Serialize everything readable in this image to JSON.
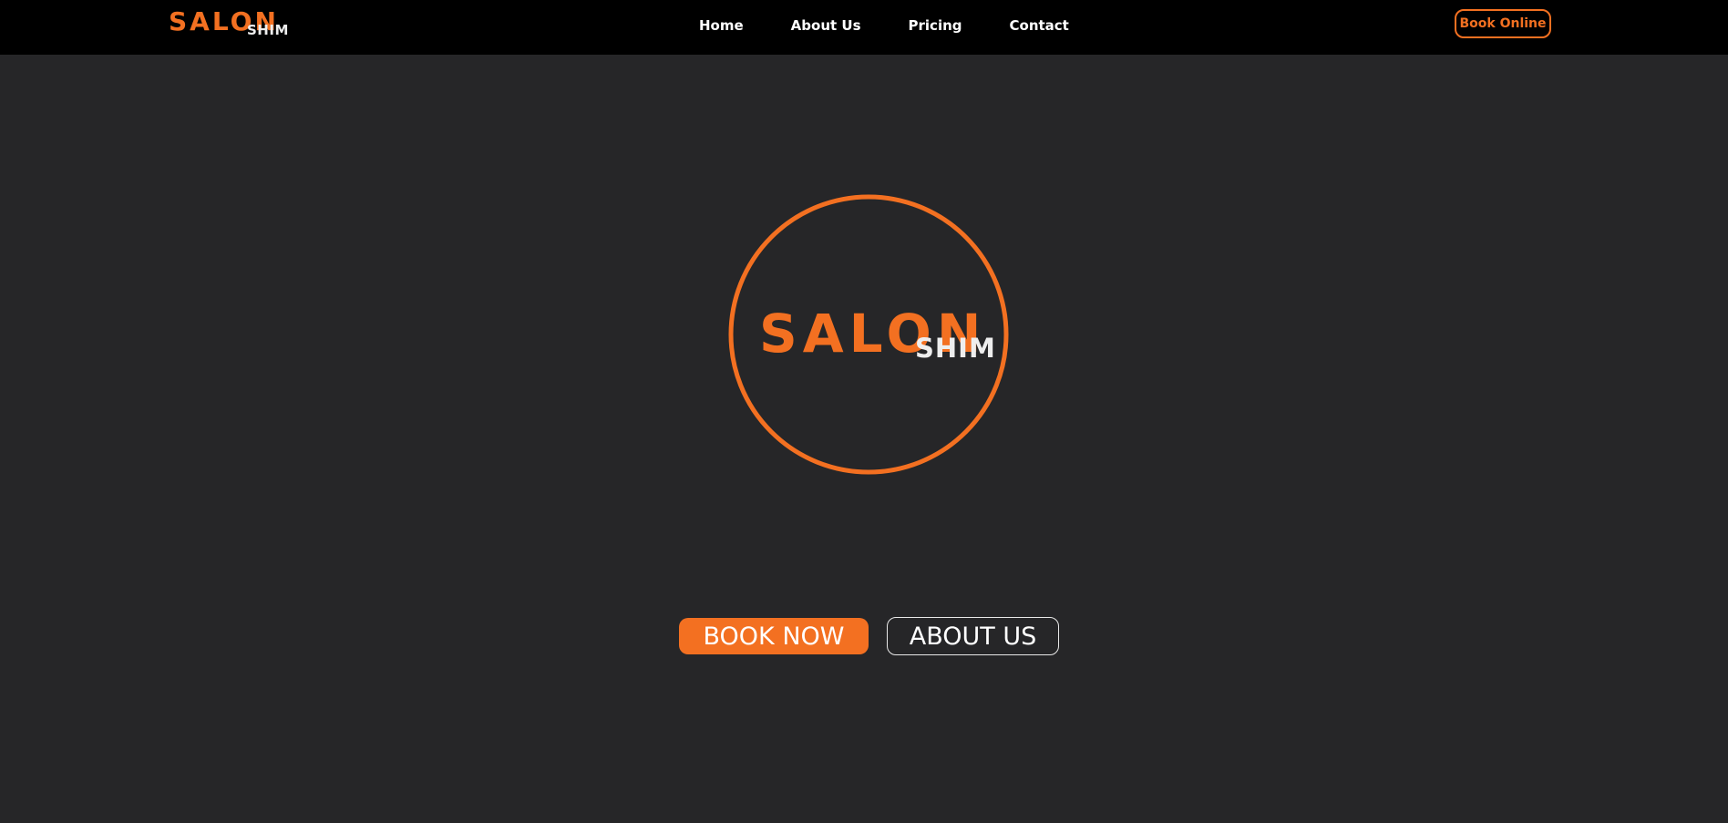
{
  "theme": {
    "accent": "#f37021",
    "nav_background": "#000000",
    "page_background": "#262628",
    "text_light": "#ffffff",
    "logo_secondary": "#eeeeee"
  },
  "header": {
    "logo": {
      "primary": "SALON",
      "secondary": "SHIM"
    },
    "nav": [
      {
        "label": "Home"
      },
      {
        "label": "About Us"
      },
      {
        "label": "Pricing"
      },
      {
        "label": "Contact"
      }
    ],
    "cta_label": "Book Online"
  },
  "hero": {
    "logo": {
      "primary": "SALON",
      "secondary": "SHIM"
    },
    "buttons": {
      "book_now": "BOOK NOW",
      "about_us": "ABOUT US"
    }
  }
}
